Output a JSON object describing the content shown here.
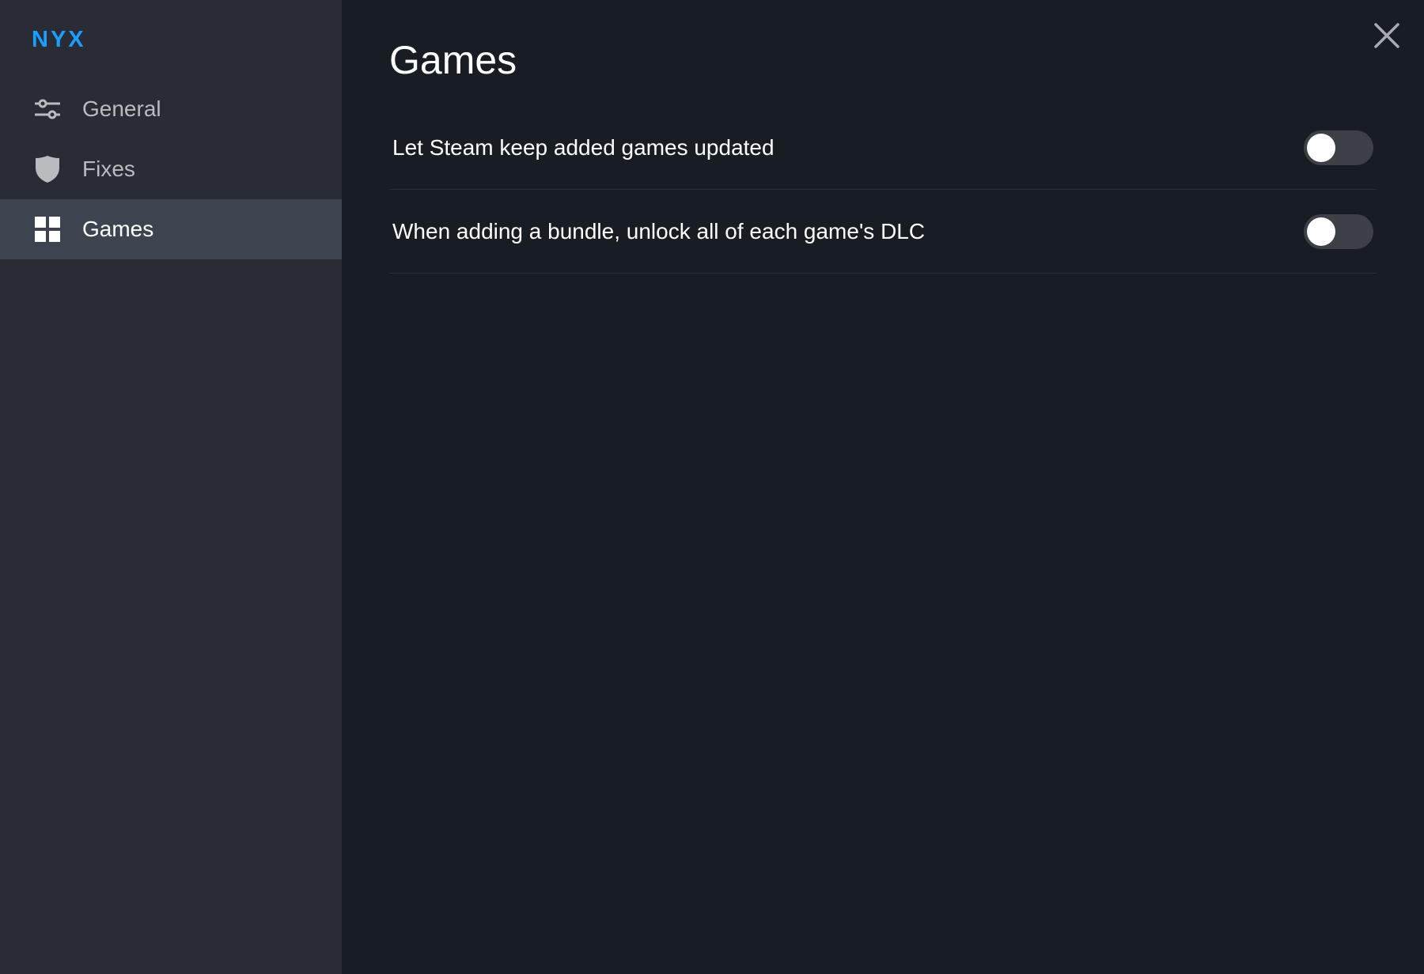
{
  "sidebar": {
    "brand": "NYX",
    "brand_color": "#1a9fff",
    "items": [
      {
        "label": "General",
        "icon": "sliders-icon",
        "active": false
      },
      {
        "label": "Fixes",
        "icon": "shield-icon",
        "active": false
      },
      {
        "label": "Games",
        "icon": "grid-icon",
        "active": true
      }
    ]
  },
  "main": {
    "title": "Games",
    "close_icon": "close-icon",
    "settings": [
      {
        "label": "Let Steam keep added games updated",
        "enabled": false
      },
      {
        "label": "When adding a bundle, unlock all of each game's DLC",
        "enabled": false
      }
    ]
  }
}
